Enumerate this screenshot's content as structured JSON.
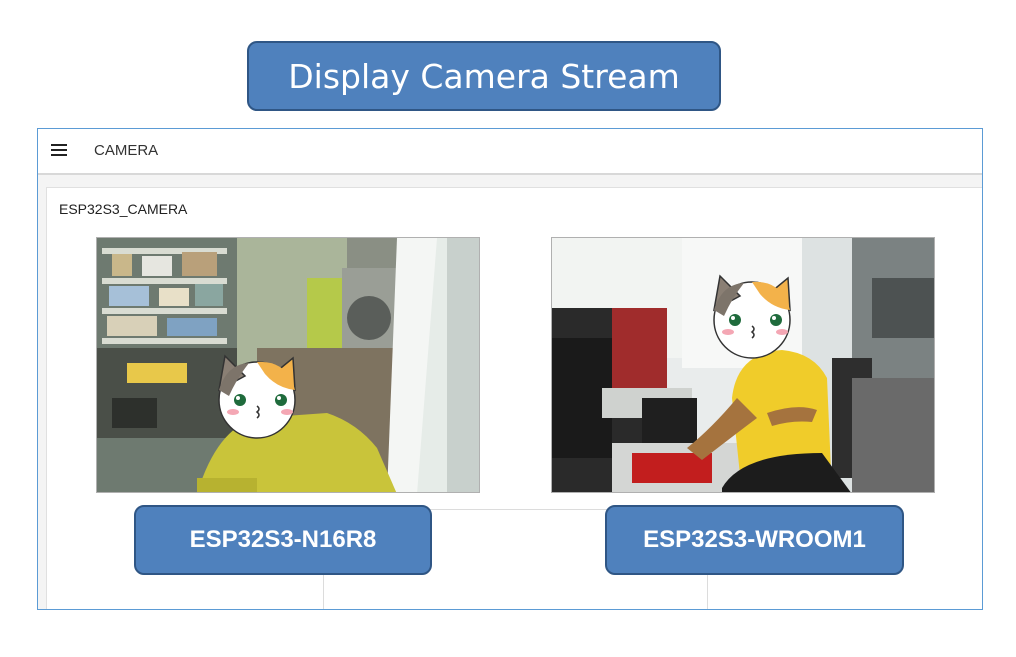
{
  "banner": {
    "title": "Display Camera Stream"
  },
  "app": {
    "title": "CAMERA",
    "menu_icon": "hamburger-menu-icon"
  },
  "card": {
    "title": "ESP32S3_CAMERA"
  },
  "cameras": [
    {
      "label": "ESP32S3-N16R8"
    },
    {
      "label": "ESP32S3-WROOM1"
    }
  ],
  "colors": {
    "accent": "#4f81bd",
    "accent_border": "#2f5685",
    "window_border": "#5b9bd5"
  }
}
